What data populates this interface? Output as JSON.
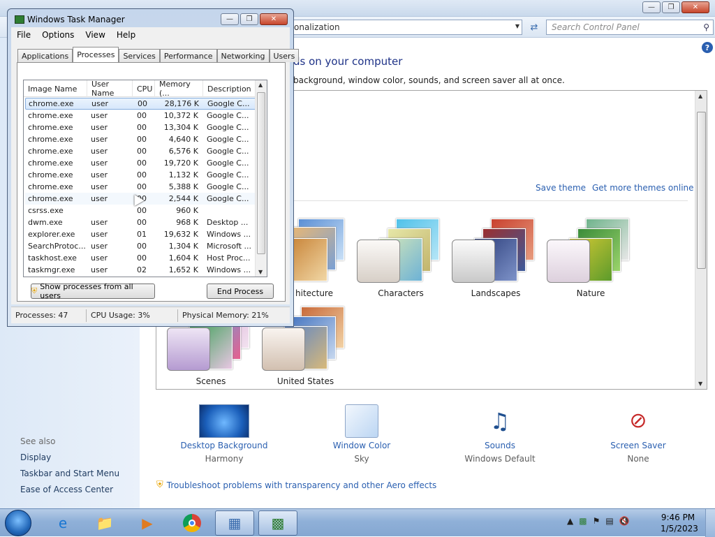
{
  "control_panel": {
    "address": "onalization",
    "search_placeholder": "Search Control Panel",
    "title": "ds on your computer",
    "subtitle": "background, window color, sounds, and screen saver all at once.",
    "links": {
      "save_theme": "Save theme",
      "get_more": "Get more themes online"
    },
    "themes": [
      {
        "label": "hitecture"
      },
      {
        "label": "Characters"
      },
      {
        "label": "Landscapes"
      },
      {
        "label": "Nature"
      },
      {
        "label": "Scenes"
      },
      {
        "label": "United States"
      }
    ],
    "see_also": "See also",
    "side_links": [
      "Display",
      "Taskbar and Start Menu",
      "Ease of Access Center"
    ],
    "bottom": [
      {
        "label": "Desktop Background",
        "sub": "Harmony"
      },
      {
        "label": "Window Color",
        "sub": "Sky"
      },
      {
        "label": "Sounds",
        "sub": "Windows Default"
      },
      {
        "label": "Screen Saver",
        "sub": "None"
      }
    ],
    "troubleshoot": "Troubleshoot problems with transparency and other Aero effects"
  },
  "task_manager": {
    "title": "Windows Task Manager",
    "menu": [
      "File",
      "Options",
      "View",
      "Help"
    ],
    "tabs": [
      "Applications",
      "Processes",
      "Services",
      "Performance",
      "Networking",
      "Users"
    ],
    "active_tab": "Processes",
    "columns": [
      "Image Name",
      "User Name",
      "CPU",
      "Memory (...",
      "Description"
    ],
    "rows": [
      {
        "name": "chrome.exe",
        "user": "user",
        "cpu": "00",
        "mem": "28,176 K",
        "desc": "Google C..."
      },
      {
        "name": "chrome.exe",
        "user": "user",
        "cpu": "00",
        "mem": "10,372 K",
        "desc": "Google C..."
      },
      {
        "name": "chrome.exe",
        "user": "user",
        "cpu": "00",
        "mem": "13,304 K",
        "desc": "Google C..."
      },
      {
        "name": "chrome.exe",
        "user": "user",
        "cpu": "00",
        "mem": "4,640 K",
        "desc": "Google C..."
      },
      {
        "name": "chrome.exe",
        "user": "user",
        "cpu": "00",
        "mem": "6,576 K",
        "desc": "Google C..."
      },
      {
        "name": "chrome.exe",
        "user": "user",
        "cpu": "00",
        "mem": "19,720 K",
        "desc": "Google C..."
      },
      {
        "name": "chrome.exe",
        "user": "user",
        "cpu": "00",
        "mem": "1,132 K",
        "desc": "Google C..."
      },
      {
        "name": "chrome.exe",
        "user": "user",
        "cpu": "00",
        "mem": "5,388 K",
        "desc": "Google C..."
      },
      {
        "name": "chrome.exe",
        "user": "user",
        "cpu": "00",
        "mem": "2,544 K",
        "desc": "Google C..."
      },
      {
        "name": "csrss.exe",
        "user": "",
        "cpu": "00",
        "mem": "960 K",
        "desc": ""
      },
      {
        "name": "dwm.exe",
        "user": "user",
        "cpu": "00",
        "mem": "968 K",
        "desc": "Desktop ..."
      },
      {
        "name": "explorer.exe",
        "user": "user",
        "cpu": "01",
        "mem": "19,632 K",
        "desc": "Windows ..."
      },
      {
        "name": "SearchProtoc...",
        "user": "user",
        "cpu": "00",
        "mem": "1,304 K",
        "desc": "Microsoft ..."
      },
      {
        "name": "taskhost.exe",
        "user": "user",
        "cpu": "00",
        "mem": "1,604 K",
        "desc": "Host Proc..."
      },
      {
        "name": "taskmgr.exe",
        "user": "user",
        "cpu": "02",
        "mem": "1,652 K",
        "desc": "Windows ..."
      }
    ],
    "show_all_button": "Show processes from all users",
    "end_process_button": "End Process",
    "status": {
      "processes": "Processes: 47",
      "cpu": "CPU Usage: 3%",
      "memory": "Physical Memory: 21%"
    }
  },
  "taskbar": {
    "time": "9:46 PM",
    "date": "1/5/2023"
  }
}
